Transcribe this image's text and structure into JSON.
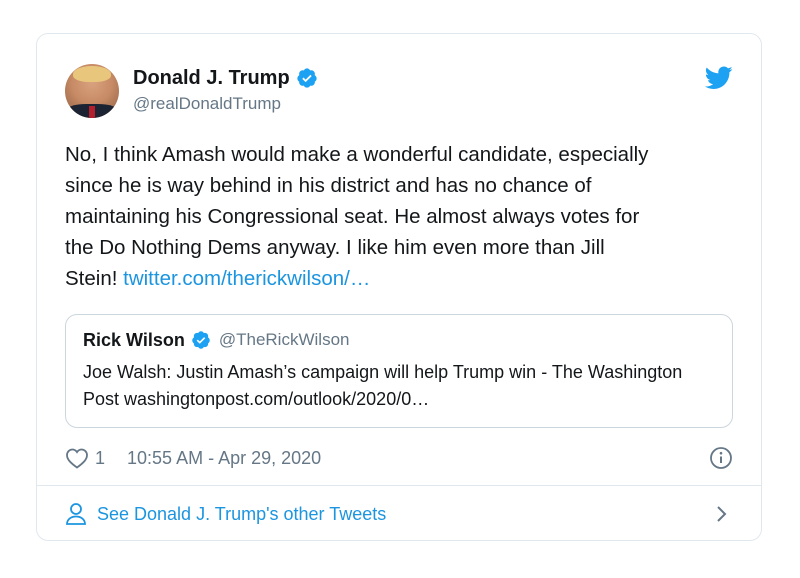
{
  "author": {
    "display_name": "Donald J. Trump",
    "handle": "@realDonaldTrump",
    "verified": true
  },
  "tweet": {
    "text": "No, I think Amash would make a wonderful candidate, especially\nsince he is way behind in his district and has no chance of\nmaintaining his Congressional seat. He almost always votes for\nthe Do Nothing Dems anyway. I like him even more than Jill\nStein! ",
    "link": "twitter.com/therickwilson/…"
  },
  "quote": {
    "display_name": "Rick Wilson",
    "handle": "@TheRickWilson",
    "verified": true,
    "text": "Joe Walsh: Justin Amash’s campaign will help Trump win - The Washington Post washingtonpost.com/outlook/2020/0…"
  },
  "meta": {
    "likes": "1",
    "timestamp": "10:55 AM - Apr 29, 2020"
  },
  "footer": {
    "label": "See Donald J. Trump's other Tweets"
  },
  "icons": {
    "brand": "twitter-bird-icon",
    "verified": "verified-badge-icon",
    "like": "heart-icon",
    "info": "info-icon",
    "profile": "person-icon",
    "next": "chevron-right-icon"
  },
  "colors": {
    "accent": "#1b95e0",
    "verified": "#1da1f2",
    "muted": "#657786",
    "border": "#e1e8ed"
  }
}
